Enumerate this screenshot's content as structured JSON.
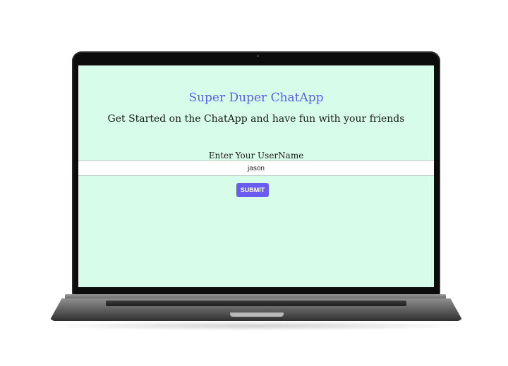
{
  "app": {
    "title": "Super Duper ChatApp",
    "subtitle": "Get Started on the ChatApp and have fun with your friends"
  },
  "login_form": {
    "username_label": "Enter Your UserName",
    "username_value": "jason",
    "submit_label": "SUBMIT"
  },
  "colors": {
    "screen_background": "#d7fdea",
    "title": "#5b5ef0",
    "submit_button": "#6a5cf0"
  }
}
